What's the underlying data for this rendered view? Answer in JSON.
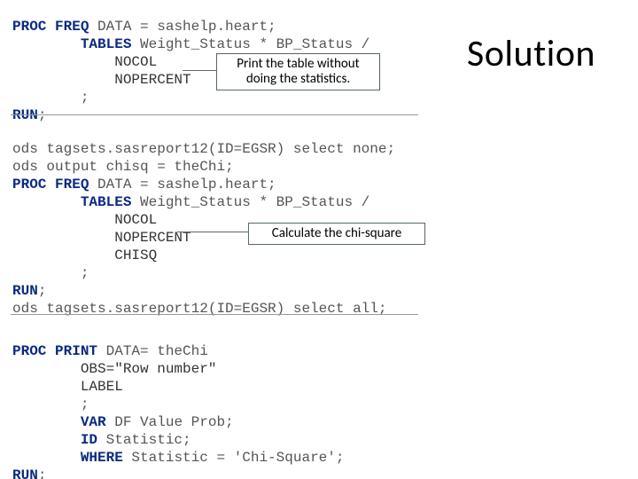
{
  "title": "Solution",
  "callouts": {
    "print_table": "Print the table without\ndoing the statistics.",
    "chi_square": "Calculate the chi-square"
  },
  "code_blocks": {
    "block1": {
      "l1a": "PROC FREQ",
      "l1b": " DATA = sashelp.heart;",
      "l2a": "        ",
      "l2b": "TABLES",
      "l2c": " Weight_Status * BP_Status /",
      "l3": "            NOCOL",
      "l4": "            NOPERCENT",
      "l5": "        ;",
      "l6a": "RUN",
      "l6b": ";"
    },
    "block2": {
      "l1": "ods tagsets.sasreport12(ID=EGSR) select none;",
      "l2": "ods output chisq = theChi;",
      "l3a": "PROC FREQ",
      "l3b": " DATA = sashelp.heart;",
      "l4a": "        ",
      "l4b": "TABLES",
      "l4c": " Weight_Status * BP_Status /",
      "l5": "            NOCOL",
      "l6": "            NOPERCENT",
      "l7": "            CHISQ",
      "l8": "        ;",
      "l9a": "RUN",
      "l9b": ";",
      "l10": "ods tagsets.sasreport12(ID=EGSR) select all;"
    },
    "block3": {
      "l1a": "PROC PRINT",
      "l1b": " DATA= theChi",
      "l2": "        OBS=\"Row number\"",
      "l3": "        LABEL",
      "l4": "        ;",
      "l5a": "        ",
      "l5b": "VAR",
      "l5c": " DF Value Prob;",
      "l6a": "        ",
      "l6b": "ID",
      "l6c": " Statistic;",
      "l7a": "        ",
      "l7b": "WHERE",
      "l7c": " Statistic = 'Chi-Square';",
      "l8a": "RUN",
      "l8b": ";"
    }
  }
}
